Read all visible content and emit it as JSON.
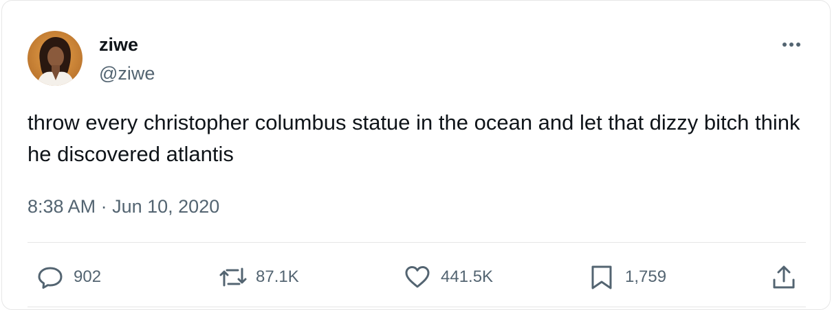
{
  "author": {
    "display_name": "ziwe",
    "handle": "@ziwe",
    "avatar_icon": "profile-photo"
  },
  "tweet": {
    "text": "throw every christopher columbus statue in the ocean and let that dizzy bitch think he discovered atlantis",
    "time": "8:38 AM",
    "separator": "·",
    "date": "Jun 10, 2020"
  },
  "actions": {
    "replies": {
      "icon": "reply-icon",
      "count": "902"
    },
    "retweets": {
      "icon": "retweet-icon",
      "count": "87.1K"
    },
    "likes": {
      "icon": "heart-icon",
      "count": "441.5K"
    },
    "bookmarks": {
      "icon": "bookmark-icon",
      "count": "1,759"
    },
    "share": {
      "icon": "share-icon"
    }
  },
  "colors": {
    "text_primary": "#0f1419",
    "text_secondary": "#536471",
    "divider": "#e6e6e6"
  }
}
